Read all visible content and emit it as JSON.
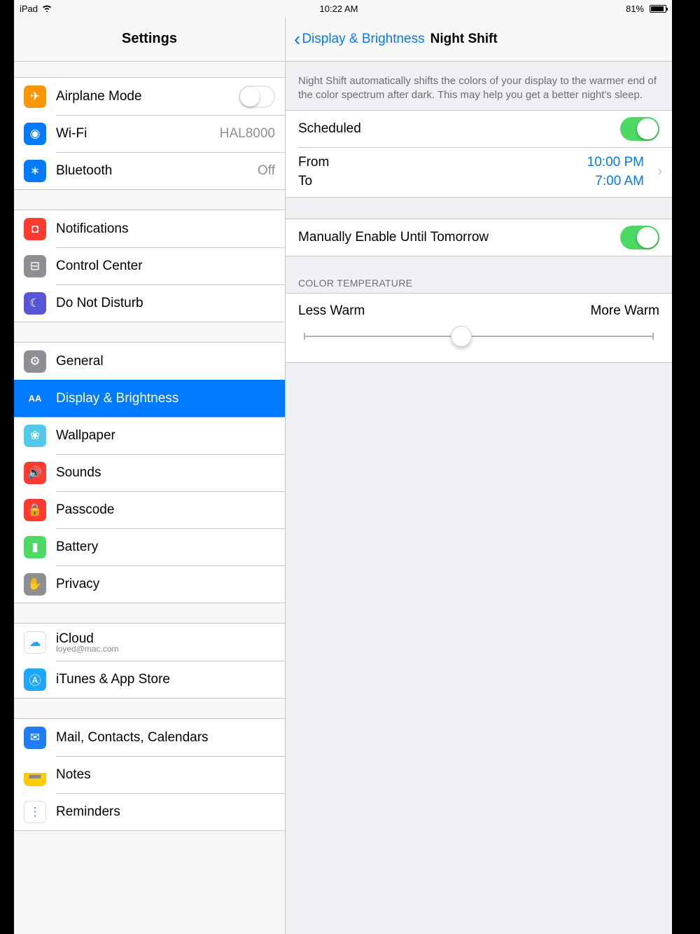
{
  "status": {
    "device": "iPad",
    "time": "10:22 AM",
    "battery_pct": "81%",
    "battery_fill_pct": 81
  },
  "sidebar": {
    "title": "Settings",
    "groups": [
      [
        {
          "icon": "airplane",
          "color": "#ff9500",
          "label": "Airplane Mode",
          "value": "",
          "switch": true
        },
        {
          "icon": "wifi",
          "color": "#007aff",
          "label": "Wi-Fi",
          "value": "HAL8000"
        },
        {
          "icon": "bluetooth",
          "color": "#007aff",
          "label": "Bluetooth",
          "value": "Off"
        }
      ],
      [
        {
          "icon": "notifications",
          "color": "#ff3b30",
          "label": "Notifications"
        },
        {
          "icon": "control",
          "color": "#8e8e93",
          "label": "Control Center"
        },
        {
          "icon": "dnd",
          "color": "#5856d6",
          "label": "Do Not Disturb"
        }
      ],
      [
        {
          "icon": "general",
          "color": "#8e8e93",
          "label": "General"
        },
        {
          "icon": "display",
          "color": "#007aff",
          "label": "Display & Brightness",
          "selected": true
        },
        {
          "icon": "wallpaper",
          "color": "#54c7ec",
          "label": "Wallpaper"
        },
        {
          "icon": "sounds",
          "color": "#ff3b30",
          "label": "Sounds"
        },
        {
          "icon": "passcode",
          "color": "#ff3b30",
          "label": "Passcode"
        },
        {
          "icon": "battery",
          "color": "#4cd964",
          "label": "Battery"
        },
        {
          "icon": "privacy",
          "color": "#8e8e93",
          "label": "Privacy"
        }
      ],
      [
        {
          "icon": "icloud",
          "color": "#ffffff",
          "label": "iCloud",
          "sub": "loyed@mac.com"
        },
        {
          "icon": "appstore",
          "color": "#1ea7fd",
          "label": "iTunes & App Store"
        }
      ],
      [
        {
          "icon": "mail",
          "color": "#1f7cf3",
          "label": "Mail, Contacts, Calendars"
        },
        {
          "icon": "notes",
          "color": "#ffcc00",
          "label": "Notes"
        },
        {
          "icon": "reminders",
          "color": "#ffffff",
          "label": "Reminders"
        }
      ]
    ]
  },
  "content": {
    "back_label": "Display & Brightness",
    "title": "Night Shift",
    "description": "Night Shift automatically shifts the colors of your display to the warmer end of the color spectrum after dark. This may help you get a better night's sleep.",
    "scheduled_label": "Scheduled",
    "scheduled_on": true,
    "from_label": "From",
    "from_value": "10:00 PM",
    "to_label": "To",
    "to_value": "7:00 AM",
    "manual_label": "Manually Enable Until Tomorrow",
    "manual_on": true,
    "temp_header": "COLOR TEMPERATURE",
    "less_warm": "Less Warm",
    "more_warm": "More Warm",
    "slider_pct": 45
  },
  "icon_glyphs": {
    "airplane": "✈",
    "wifi": "◉",
    "bluetooth": "∗",
    "notifications": "◘",
    "control": "⊟",
    "dnd": "☾",
    "general": "⚙",
    "display": "AA",
    "wallpaper": "❀",
    "sounds": "🔊",
    "passcode": "🔒",
    "battery": "▮",
    "privacy": "✋",
    "icloud": "☁",
    "appstore": "Ⓐ",
    "mail": "✉",
    "notes": "▬",
    "reminders": "⋮"
  }
}
